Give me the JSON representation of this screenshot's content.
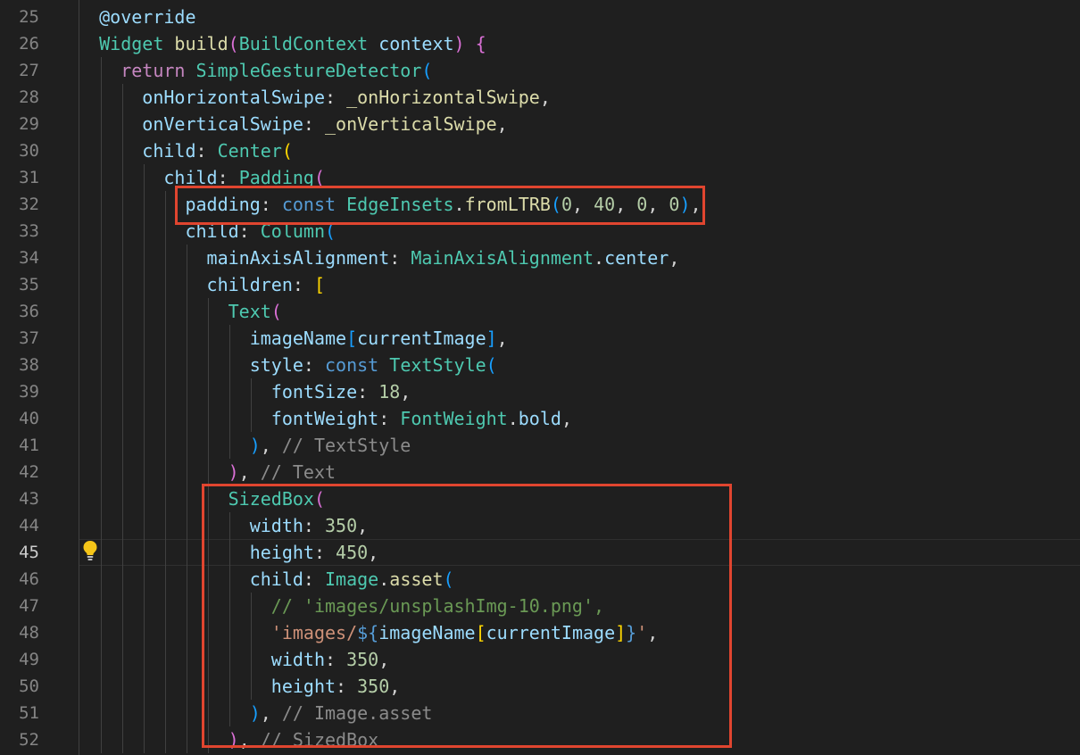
{
  "editor": {
    "active_line": 45,
    "lines": [
      {
        "num": "25",
        "segs": [
          [
            "",
            "      "
          ],
          [
            "prop",
            "@override"
          ]
        ]
      },
      {
        "num": "26",
        "segs": [
          [
            "",
            "      "
          ],
          [
            "cls",
            "Widget"
          ],
          [
            "",
            " "
          ],
          [
            "fn",
            "build"
          ],
          [
            "p2",
            "("
          ],
          [
            "cls",
            "BuildContext"
          ],
          [
            "",
            " "
          ],
          [
            "prop",
            "context"
          ],
          [
            "p2",
            ")"
          ],
          [
            "",
            " "
          ],
          [
            "p2",
            "{"
          ]
        ]
      },
      {
        "num": "27",
        "segs": [
          [
            "",
            "        "
          ],
          [
            "kw2",
            "return"
          ],
          [
            "",
            " "
          ],
          [
            "cls",
            "SimpleGestureDetector"
          ],
          [
            "p3",
            "("
          ]
        ]
      },
      {
        "num": "28",
        "segs": [
          [
            "",
            "          "
          ],
          [
            "prop",
            "onHorizontalSwipe"
          ],
          [
            "",
            ": "
          ],
          [
            "fn",
            "_onHorizontalSwipe"
          ],
          [
            "",
            ","
          ]
        ]
      },
      {
        "num": "29",
        "segs": [
          [
            "",
            "          "
          ],
          [
            "prop",
            "onVerticalSwipe"
          ],
          [
            "",
            ": "
          ],
          [
            "fn",
            "_onVerticalSwipe"
          ],
          [
            "",
            ","
          ]
        ]
      },
      {
        "num": "30",
        "segs": [
          [
            "",
            "          "
          ],
          [
            "prop",
            "child"
          ],
          [
            "",
            ": "
          ],
          [
            "cls",
            "Center"
          ],
          [
            "p1",
            "("
          ]
        ]
      },
      {
        "num": "31",
        "segs": [
          [
            "",
            "            "
          ],
          [
            "prop",
            "child"
          ],
          [
            "",
            ": "
          ],
          [
            "cls",
            "Padding"
          ],
          [
            "p2",
            "("
          ]
        ]
      },
      {
        "num": "32",
        "segs": [
          [
            "",
            "              "
          ],
          [
            "prop",
            "padding"
          ],
          [
            "",
            ": "
          ],
          [
            "kw",
            "const"
          ],
          [
            "",
            " "
          ],
          [
            "cls",
            "EdgeInsets"
          ],
          [
            "",
            "."
          ],
          [
            "fn",
            "fromLTRB"
          ],
          [
            "p3",
            "("
          ],
          [
            "num",
            "0"
          ],
          [
            "",
            ", "
          ],
          [
            "num",
            "40"
          ],
          [
            "",
            ", "
          ],
          [
            "num",
            "0"
          ],
          [
            "",
            ", "
          ],
          [
            "num",
            "0"
          ],
          [
            "p3",
            ")"
          ],
          [
            "",
            ","
          ]
        ]
      },
      {
        "num": "33",
        "segs": [
          [
            "",
            "              "
          ],
          [
            "prop",
            "child"
          ],
          [
            "",
            ": "
          ],
          [
            "cls",
            "Column"
          ],
          [
            "p3",
            "("
          ]
        ]
      },
      {
        "num": "34",
        "segs": [
          [
            "",
            "                "
          ],
          [
            "prop",
            "mainAxisAlignment"
          ],
          [
            "",
            ": "
          ],
          [
            "cls",
            "MainAxisAlignment"
          ],
          [
            "",
            "."
          ],
          [
            "prop",
            "center"
          ],
          [
            "",
            ","
          ]
        ]
      },
      {
        "num": "35",
        "segs": [
          [
            "",
            "                "
          ],
          [
            "prop",
            "children"
          ],
          [
            "",
            ": "
          ],
          [
            "p1",
            "["
          ]
        ]
      },
      {
        "num": "36",
        "segs": [
          [
            "",
            "                  "
          ],
          [
            "cls",
            "Text"
          ],
          [
            "p2",
            "("
          ]
        ]
      },
      {
        "num": "37",
        "segs": [
          [
            "",
            "                    "
          ],
          [
            "prop",
            "imageName"
          ],
          [
            "p3",
            "["
          ],
          [
            "prop",
            "currentImage"
          ],
          [
            "p3",
            "]"
          ],
          [
            "",
            ","
          ]
        ]
      },
      {
        "num": "38",
        "segs": [
          [
            "",
            "                    "
          ],
          [
            "prop",
            "style"
          ],
          [
            "",
            ": "
          ],
          [
            "kw",
            "const"
          ],
          [
            "",
            " "
          ],
          [
            "cls",
            "TextStyle"
          ],
          [
            "p3",
            "("
          ]
        ]
      },
      {
        "num": "39",
        "segs": [
          [
            "",
            "                      "
          ],
          [
            "prop",
            "fontSize"
          ],
          [
            "",
            ": "
          ],
          [
            "num",
            "18"
          ],
          [
            "",
            ","
          ]
        ]
      },
      {
        "num": "40",
        "segs": [
          [
            "",
            "                      "
          ],
          [
            "prop",
            "fontWeight"
          ],
          [
            "",
            ": "
          ],
          [
            "cls",
            "FontWeight"
          ],
          [
            "",
            "."
          ],
          [
            "prop",
            "bold"
          ],
          [
            "",
            ","
          ]
        ]
      },
      {
        "num": "41",
        "segs": [
          [
            "",
            "                    "
          ],
          [
            "p3",
            ")"
          ],
          [
            "",
            ", "
          ],
          [
            "cmt-grey",
            "// TextStyle"
          ]
        ]
      },
      {
        "num": "42",
        "segs": [
          [
            "",
            "                  "
          ],
          [
            "p2",
            ")"
          ],
          [
            "",
            ", "
          ],
          [
            "cmt-grey",
            "// Text"
          ]
        ]
      },
      {
        "num": "43",
        "segs": [
          [
            "",
            "                  "
          ],
          [
            "cls",
            "SizedBox"
          ],
          [
            "p2",
            "("
          ]
        ]
      },
      {
        "num": "44",
        "segs": [
          [
            "",
            "                    "
          ],
          [
            "prop",
            "width"
          ],
          [
            "",
            ": "
          ],
          [
            "num",
            "350"
          ],
          [
            "",
            ","
          ]
        ]
      },
      {
        "num": "45",
        "segs": [
          [
            "",
            "                    "
          ],
          [
            "prop",
            "height"
          ],
          [
            "",
            ": "
          ],
          [
            "num",
            "450"
          ],
          [
            "",
            ","
          ]
        ]
      },
      {
        "num": "46",
        "segs": [
          [
            "",
            "                    "
          ],
          [
            "prop",
            "child"
          ],
          [
            "",
            ": "
          ],
          [
            "cls",
            "Image"
          ],
          [
            "",
            "."
          ],
          [
            "fn",
            "asset"
          ],
          [
            "p3",
            "("
          ]
        ]
      },
      {
        "num": "47",
        "segs": [
          [
            "",
            "                      "
          ],
          [
            "cmt",
            "// 'images/unsplashImg-10.png',"
          ]
        ]
      },
      {
        "num": "48",
        "segs": [
          [
            "",
            "                      "
          ],
          [
            "str",
            "'images/"
          ],
          [
            "kw",
            "${"
          ],
          [
            "prop",
            "imageName"
          ],
          [
            "p1",
            "["
          ],
          [
            "prop",
            "currentImage"
          ],
          [
            "p1",
            "]"
          ],
          [
            "kw",
            "}"
          ],
          [
            "str",
            "'"
          ],
          [
            "",
            ","
          ]
        ]
      },
      {
        "num": "49",
        "segs": [
          [
            "",
            "                      "
          ],
          [
            "prop",
            "width"
          ],
          [
            "",
            ": "
          ],
          [
            "num",
            "350"
          ],
          [
            "",
            ","
          ]
        ]
      },
      {
        "num": "50",
        "segs": [
          [
            "",
            "                      "
          ],
          [
            "prop",
            "height"
          ],
          [
            "",
            ": "
          ],
          [
            "num",
            "350"
          ],
          [
            "",
            ","
          ]
        ]
      },
      {
        "num": "51",
        "segs": [
          [
            "",
            "                    "
          ],
          [
            "p3",
            ")"
          ],
          [
            "",
            ", "
          ],
          [
            "cmt-grey",
            "// Image.asset"
          ]
        ]
      },
      {
        "num": "52",
        "segs": [
          [
            "",
            "                  "
          ],
          [
            "p2",
            ")"
          ],
          [
            "",
            ", "
          ],
          [
            "cmt-grey",
            "// SizedBox"
          ]
        ]
      }
    ]
  },
  "icons": {
    "lightbulb": "lightbulb-icon"
  },
  "colors": {
    "background": "#1f1f1f",
    "highlight_border": "#e0452f",
    "line_number": "#858585",
    "active_line_number": "#cccccc"
  }
}
